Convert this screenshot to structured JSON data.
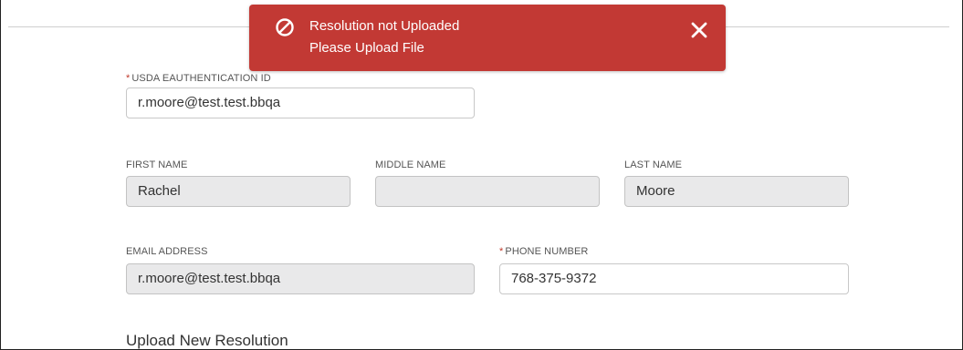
{
  "toast": {
    "icon": "ban-icon",
    "title": "Resolution not Uploaded",
    "message": "Please Upload File",
    "close_icon": "close-icon",
    "color": "#c23934"
  },
  "form": {
    "eauth": {
      "required": "*",
      "label": "USDA EAUTHENTICATION ID",
      "value": "r.moore@test.test.bbqa"
    },
    "first_name": {
      "label": "FIRST NAME",
      "value": "Rachel"
    },
    "middle_name": {
      "label": "MIDDLE NAME",
      "value": ""
    },
    "last_name": {
      "label": "LAST NAME",
      "value": "Moore"
    },
    "email": {
      "label": "EMAIL ADDRESS",
      "value": "r.moore@test.test.bbqa"
    },
    "phone": {
      "required": "*",
      "label": "PHONE NUMBER",
      "value": "768-375-9372"
    }
  },
  "upload_section": {
    "title": "Upload New Resolution"
  },
  "colors": {
    "required_marker": "#c0392b",
    "disabled_field": "#e9e9ea"
  }
}
